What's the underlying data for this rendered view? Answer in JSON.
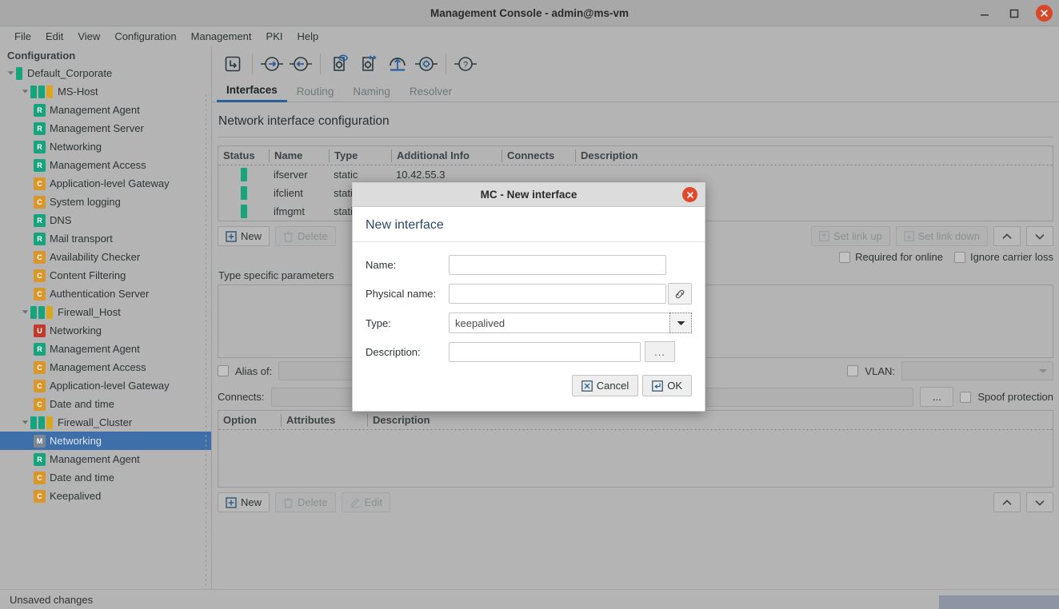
{
  "window": {
    "title": "Management Console - admin@ms-vm",
    "minimize_icon": "minimize-icon",
    "maximize_icon": "maximize-icon",
    "close_icon": "close-icon"
  },
  "menubar": {
    "items": [
      "File",
      "Edit",
      "View",
      "Configuration",
      "Management",
      "PKI",
      "Help"
    ]
  },
  "sidebar": {
    "header": "Configuration",
    "nodes": [
      {
        "label": "Default_Corporate",
        "indent": 0,
        "kind": "root",
        "marks": [
          "g"
        ],
        "twisty": "down"
      },
      {
        "label": "MS-Host",
        "indent": 1,
        "kind": "host",
        "marks": [
          "g",
          "g",
          "y"
        ],
        "twisty": "down"
      },
      {
        "label": "Management Agent",
        "indent": 2,
        "kind": "leaf",
        "badge": "R"
      },
      {
        "label": "Management Server",
        "indent": 2,
        "kind": "leaf",
        "badge": "R"
      },
      {
        "label": "Networking",
        "indent": 2,
        "kind": "leaf",
        "badge": "R"
      },
      {
        "label": "Management Access",
        "indent": 2,
        "kind": "leaf",
        "badge": "R"
      },
      {
        "label": "Application-level Gateway",
        "indent": 2,
        "kind": "leaf",
        "badge": "C"
      },
      {
        "label": "System logging",
        "indent": 2,
        "kind": "leaf",
        "badge": "C"
      },
      {
        "label": "DNS",
        "indent": 2,
        "kind": "leaf",
        "badge": "R"
      },
      {
        "label": "Mail transport",
        "indent": 2,
        "kind": "leaf",
        "badge": "R"
      },
      {
        "label": "Availability Checker",
        "indent": 2,
        "kind": "leaf",
        "badge": "C"
      },
      {
        "label": "Content Filtering",
        "indent": 2,
        "kind": "leaf",
        "badge": "C"
      },
      {
        "label": "Authentication Server",
        "indent": 2,
        "kind": "leaf",
        "badge": "C"
      },
      {
        "label": "Firewall_Host",
        "indent": 1,
        "kind": "host",
        "marks": [
          "g",
          "g",
          "y"
        ],
        "twisty": "down"
      },
      {
        "label": "Networking",
        "indent": 2,
        "kind": "leaf",
        "badge": "U"
      },
      {
        "label": "Management Agent",
        "indent": 2,
        "kind": "leaf",
        "badge": "R"
      },
      {
        "label": "Management Access",
        "indent": 2,
        "kind": "leaf",
        "badge": "C"
      },
      {
        "label": "Application-level Gateway",
        "indent": 2,
        "kind": "leaf",
        "badge": "C"
      },
      {
        "label": "Date and time",
        "indent": 2,
        "kind": "leaf",
        "badge": "C"
      },
      {
        "label": "Firewall_Cluster",
        "indent": 1,
        "kind": "host",
        "marks": [
          "g",
          "g",
          "y"
        ],
        "twisty": "down"
      },
      {
        "label": "Networking",
        "indent": 2,
        "kind": "leaf",
        "badge": "M",
        "selected": true
      },
      {
        "label": "Management Agent",
        "indent": 2,
        "kind": "leaf",
        "badge": "R"
      },
      {
        "label": "Date and time",
        "indent": 2,
        "kind": "leaf",
        "badge": "C"
      },
      {
        "label": "Keepalived",
        "indent": 2,
        "kind": "leaf",
        "badge": "C"
      }
    ]
  },
  "toolbar": {
    "buttons": [
      "go-up-icon",
      "forward-icon",
      "back-icon",
      "view-settings-icon",
      "transfer-settings-icon",
      "upload-icon",
      "settings-icon",
      "help-icon"
    ]
  },
  "tabs": [
    {
      "label": "Interfaces",
      "active": true
    },
    {
      "label": "Routing",
      "active": false
    },
    {
      "label": "Naming",
      "active": false
    },
    {
      "label": "Resolver",
      "active": false
    }
  ],
  "page": {
    "title": "Network interface configuration"
  },
  "interfaces_table": {
    "columns": [
      "Status",
      "Name",
      "Type",
      "Additional Info",
      "Connects",
      "Description"
    ],
    "rows": [
      {
        "status": "up",
        "name": "ifserver",
        "type": "static",
        "info": "10.42.55.3",
        "connects": "",
        "description": ""
      },
      {
        "status": "up",
        "name": "ifclient",
        "type": "static",
        "info": "",
        "connects": "",
        "description": ""
      },
      {
        "status": "up",
        "name": "ifmgmt",
        "type": "static",
        "info": "",
        "connects": "",
        "description": ""
      }
    ]
  },
  "interface_toolbar": {
    "new_label": "New",
    "delete_label": "Delete",
    "set_link_up_label": "Set link up",
    "set_link_down_label": "Set link down",
    "move_up_icon": "chevron-up-icon",
    "move_down_icon": "chevron-down-icon"
  },
  "interface_checkboxes": [
    {
      "label": "Required for online",
      "checked": false
    },
    {
      "label": "Ignore carrier loss",
      "checked": false
    }
  ],
  "type_params": {
    "label": "Type specific parameters"
  },
  "bottom_fields": {
    "alias_of_label": "Alias of:",
    "alias_of_checked": false,
    "alias_of_value": "",
    "vlan_label": "VLAN:",
    "vlan_checked": false,
    "vlan_value": "",
    "connects_label": "Connects:",
    "connects_value": "",
    "connects_browse_label": "...",
    "spoof_protection_label": "Spoof protection",
    "spoof_protection_checked": false
  },
  "options_table": {
    "columns": [
      "Option",
      "Attributes",
      "Description"
    ],
    "rows": []
  },
  "options_toolbar": {
    "new_label": "New",
    "delete_label": "Delete",
    "edit_label": "Edit",
    "move_up_icon": "chevron-up-icon",
    "move_down_icon": "chevron-down-icon"
  },
  "statusbar": {
    "text": "Unsaved changes"
  },
  "dialog": {
    "titlebar": "MC - New interface",
    "heading": "New interface",
    "close_icon": "close-icon",
    "fields": {
      "name_label": "Name:",
      "name_value": "",
      "physical_name_label": "Physical name:",
      "physical_name_value": "",
      "physical_name_button_icon": "link-icon",
      "type_label": "Type:",
      "type_value": "keepalived",
      "description_label": "Description:",
      "description_value": "",
      "description_button_label": "..."
    },
    "cancel_label": "Cancel",
    "ok_label": "OK"
  },
  "colors": {
    "window_bg": "#b4b4b4",
    "selection": "#3f6fa8",
    "accent_tab": "#2a6099",
    "status_ok": "#17a47c",
    "badge_runtime": "#17a47c",
    "badge_config": "#d9962a",
    "badge_unavailable": "#c0392b",
    "badge_modified": "#7b8794",
    "close_button": "#d8472a",
    "icon_blue": "#2a6099"
  }
}
